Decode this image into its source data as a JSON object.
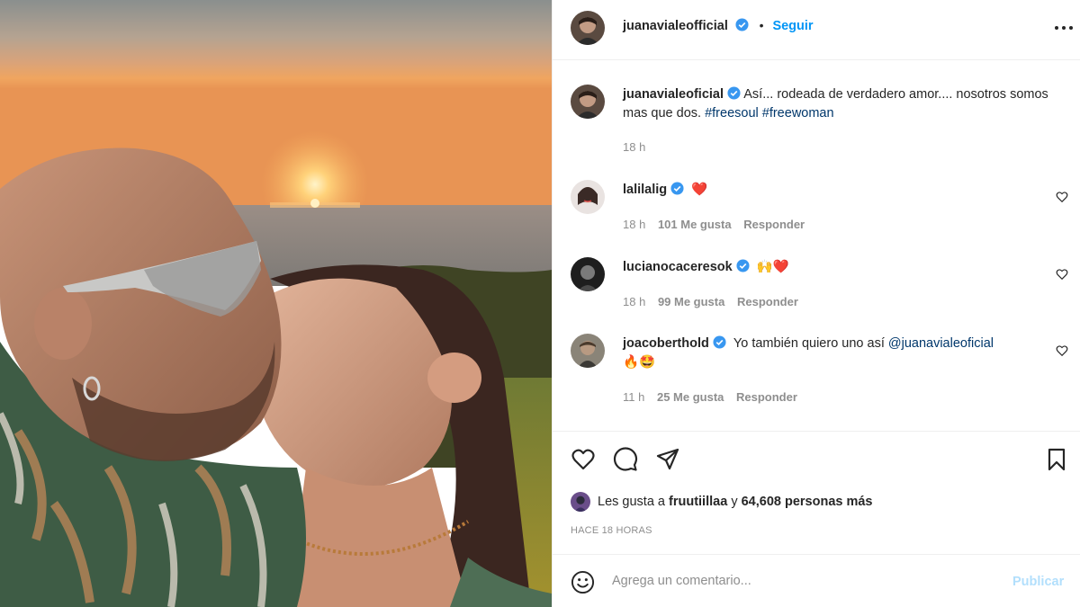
{
  "post": {
    "author": "juanavialeofficial",
    "follow_label": "Seguir",
    "separator": "•",
    "more_icon": "more-horizontal-icon",
    "caption": {
      "username": "juanavialeoficial",
      "text": "Así... rodeada de verdadero amor.... nosotros somos mas que dos. ",
      "hashtags": [
        "#freesoul",
        "#freewoman"
      ],
      "time": "18 h"
    }
  },
  "comments": [
    {
      "username": "lalilalig",
      "verified": true,
      "text": "❤️",
      "time": "18 h",
      "likes": "101 Me gusta",
      "reply": "Responder"
    },
    {
      "username": "lucianocaceresok",
      "verified": true,
      "text": "🙌❤️",
      "time": "18 h",
      "likes": "99 Me gusta",
      "reply": "Responder"
    },
    {
      "username": "joacoberthold",
      "verified": true,
      "text": "Yo también quiero uno así ",
      "mention": "@juanavialeoficial",
      "text2": "🔥🤩",
      "time": "11 h",
      "likes": "25 Me gusta",
      "reply": "Responder"
    }
  ],
  "actions": {
    "icons": [
      "heart-icon",
      "comment-icon",
      "share-icon",
      "bookmark-icon"
    ]
  },
  "likes": {
    "prefix": "Les gusta a ",
    "user": "fruutiillaa",
    "middle": " y ",
    "count": "64,608 personas más"
  },
  "posted": "HACE 18 HORAS",
  "composer": {
    "placeholder": "Agrega un comentario...",
    "publish_label": "Publicar"
  },
  "colors": {
    "accent": "#0095f6",
    "verified": "#3897f0",
    "heart": "#ed4956",
    "muted": "#8e8e8e"
  }
}
